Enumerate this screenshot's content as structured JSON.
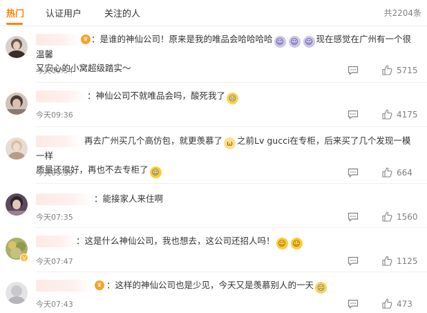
{
  "tabs": [
    {
      "label": "热门",
      "active": true
    },
    {
      "label": "认证用户",
      "active": false
    },
    {
      "label": "关注的人",
      "active": false
    }
  ],
  "total": "共2204条",
  "accent_color": "#ff8200",
  "comments": [
    {
      "text_1": "：是谁的神仙公司！原来是我的唯品会哈哈哈哈",
      "text_2": "现在感觉在广州有一个很温馨",
      "text_3": "又安心的小窝超级踏实～",
      "time": "今天09:54",
      "likes": "5715",
      "emojis": [
        "purple-face-icon",
        "purple-face-icon",
        "purple-face-icon"
      ]
    },
    {
      "text_1": "：神仙公司不就唯品会吗，酸死我了",
      "time": "今天09:36",
      "likes": "4175",
      "emojis": [
        "crying-face-icon"
      ]
    },
    {
      "text_1": "再去广州买几个高仿包，就更羡慕了",
      "text_2": "之前Lv gucci在专柜，后来买了几个发现一模一样",
      "text_3": "质量还很好，再也不去专柜了",
      "time": "今天09:35",
      "likes": "664",
      "emojis": [
        "cat-face-icon",
        "laughing-face-icon"
      ]
    },
    {
      "text_1": "：能接家人来住啊",
      "time": "今天07:35",
      "likes": "1560"
    },
    {
      "text_1": "：这是什么神仙公司，我也想去，这公司还招人吗！",
      "time": "今天07:47",
      "likes": "1125",
      "emojis": [
        "surprised-face-icon",
        "surprised-face-icon"
      ]
    },
    {
      "text_1": "：这样的神仙公司也是少见，今天又是羡慕别人的一天",
      "time": "今天07:43",
      "likes": "473",
      "emojis": [
        "drooling-face-icon",
        "crying-face-icon"
      ]
    }
  ]
}
